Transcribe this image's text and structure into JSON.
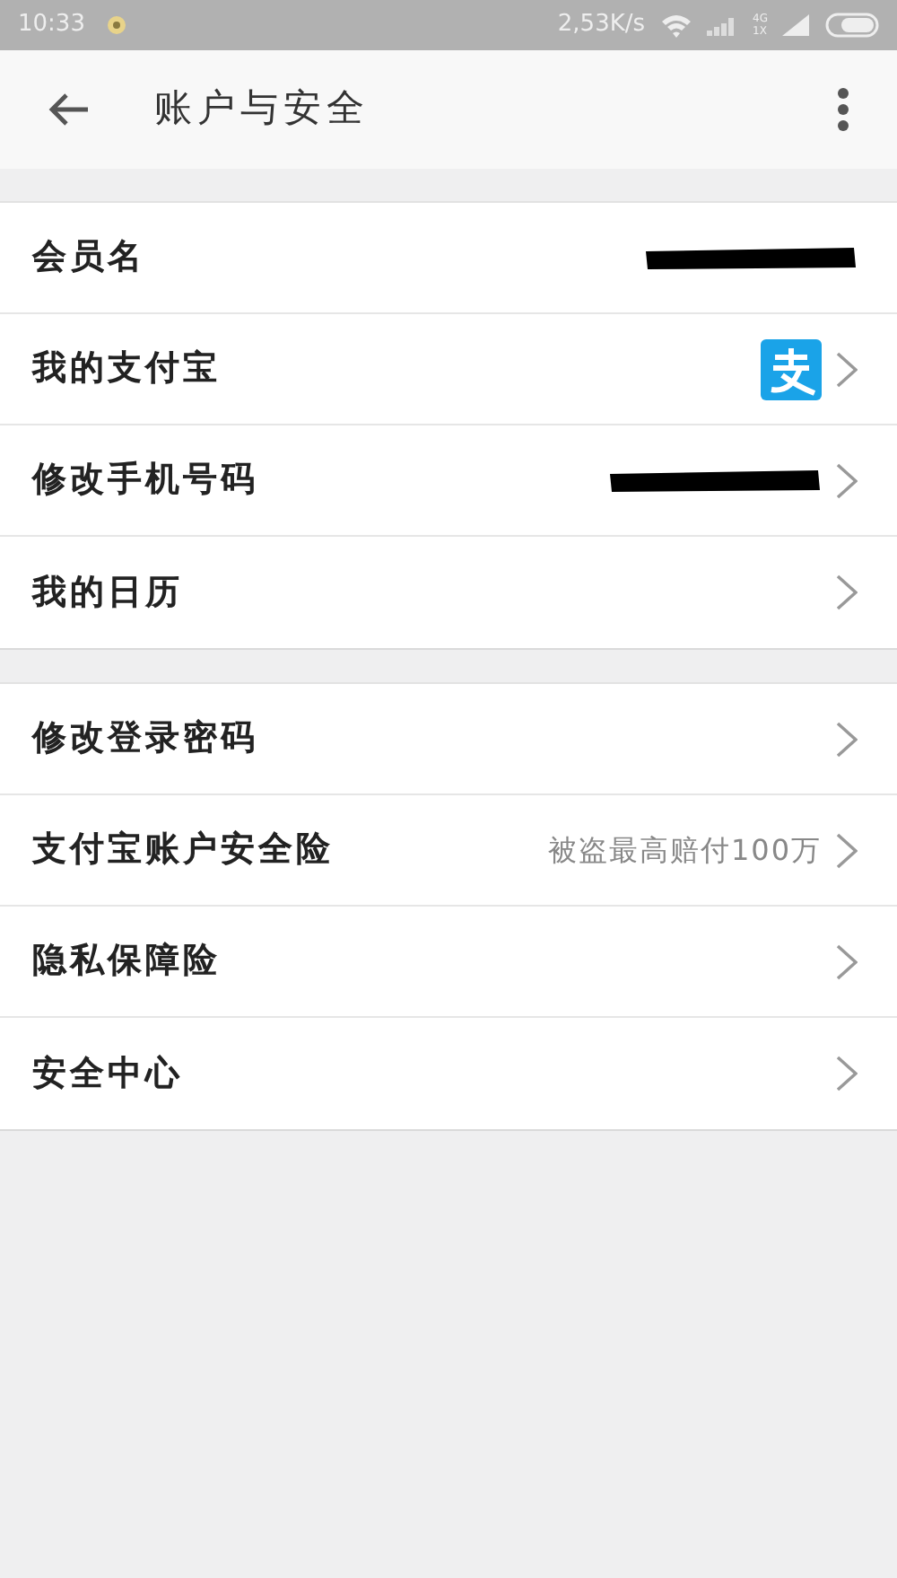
{
  "status_bar": {
    "time": "10:33",
    "speed": "2,53K/s",
    "network_top": "4G",
    "network_bottom": "1X"
  },
  "header": {
    "title": "账户与安全"
  },
  "groups": [
    {
      "rows": [
        {
          "label": "会员名",
          "kind": "redacted",
          "chevron": false
        },
        {
          "label": "我的支付宝",
          "kind": "logo",
          "chevron": true
        },
        {
          "label": "修改手机号码",
          "kind": "redacted",
          "chevron": true
        },
        {
          "label": "我的日历",
          "kind": "plain",
          "chevron": true
        }
      ]
    },
    {
      "rows": [
        {
          "label": "修改登录密码",
          "kind": "plain",
          "chevron": true
        },
        {
          "label": "支付宝账户安全险",
          "kind": "value",
          "value": "被盗最高赔付100万",
          "chevron": true
        },
        {
          "label": "隐私保障险",
          "kind": "plain",
          "chevron": true
        },
        {
          "label": "安全中心",
          "kind": "plain",
          "chevron": true
        }
      ]
    }
  ]
}
